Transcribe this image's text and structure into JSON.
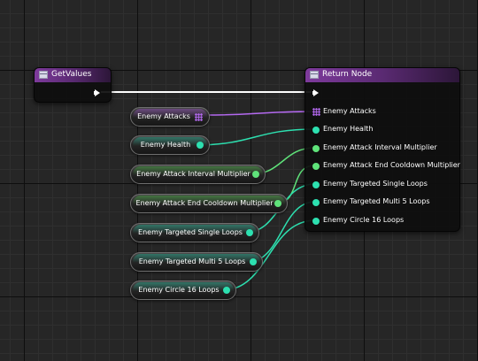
{
  "colors": {
    "exec": "#ffffff",
    "array_pin": "#b469f0",
    "float_pin": "#5fe37a",
    "int_pin": "#2de0b0",
    "header_purple": "#7e3a9c"
  },
  "get_values_node": {
    "title": "GetValues",
    "icon": "function-icon"
  },
  "return_node": {
    "title": "Return Node",
    "icon": "function-icon",
    "pins": [
      {
        "label": "Enemy Attacks",
        "type": "array"
      },
      {
        "label": "Enemy Health",
        "type": "int"
      },
      {
        "label": "Enemy Attack Interval Multiplier",
        "type": "float"
      },
      {
        "label": "Enemy Attack End Cooldown Multiplier",
        "type": "float"
      },
      {
        "label": "Enemy Targeted Single Loops",
        "type": "int"
      },
      {
        "label": "Enemy Targeted Multi 5 Loops",
        "type": "int"
      },
      {
        "label": "Enemy Circle 16 Loops",
        "type": "int"
      }
    ]
  },
  "variables": [
    {
      "label": "Enemy Attacks",
      "type": "array"
    },
    {
      "label": "Enemy Health",
      "type": "int"
    },
    {
      "label": "Enemy Attack Interval Multiplier",
      "type": "float"
    },
    {
      "label": "Enemy Attack End Cooldown Multiplier",
      "type": "float"
    },
    {
      "label": "Enemy Targeted Single Loops",
      "type": "int"
    },
    {
      "label": "Enemy Targeted Multi 5 Loops",
      "type": "int"
    },
    {
      "label": "Enemy Circle 16 Loops",
      "type": "int"
    }
  ]
}
